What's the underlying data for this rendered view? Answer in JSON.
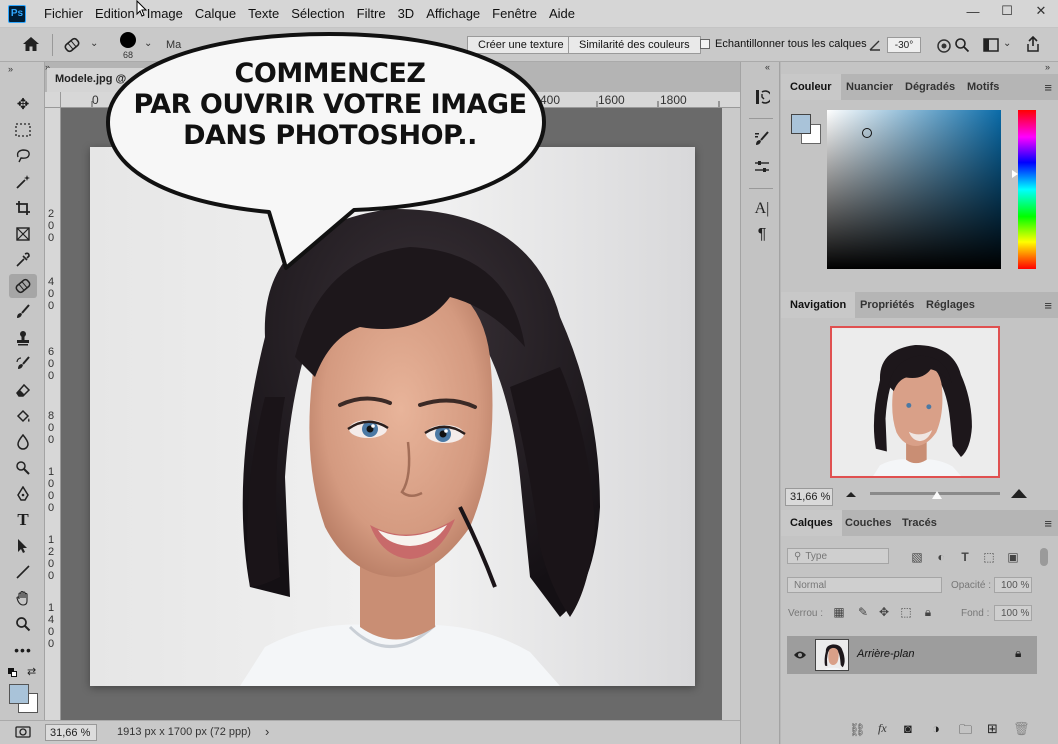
{
  "app": {
    "logo_text": "Ps"
  },
  "menu": [
    "Fichier",
    "Edition",
    "Image",
    "Calque",
    "Texte",
    "Sélection",
    "Filtre",
    "3D",
    "Affichage",
    "Fenêtre",
    "Aide"
  ],
  "window_controls": {
    "minimize": "—",
    "maximize": "☐",
    "close": "✕"
  },
  "options_bar": {
    "brush_size": "68",
    "mode_label": "Ma",
    "create_texture": "Créer une texture",
    "color_similarity": "Similarité des couleurs",
    "sample_all_layers": "Echantillonner tous les calques",
    "angle_value": "-30°"
  },
  "document": {
    "tab_title": "Modele.jpg @",
    "ruler_labels": [
      "0",
      "400",
      "1600",
      "1800"
    ],
    "left_ruler_labels": [
      "2",
      "0",
      "0",
      "4",
      "0",
      "0",
      "6",
      "0",
      "0",
      "8",
      "0",
      "0",
      "1",
      "0",
      "0",
      "0",
      "1",
      "2",
      "0",
      "0",
      "1",
      "4",
      "0",
      "0"
    ]
  },
  "status": {
    "zoom": "31,66 %",
    "dimensions": "1913 px x 1700 px (72 ppp)",
    "arrow": "›"
  },
  "speech_bubble": {
    "lines": [
      "COMMENCEZ",
      "PAR OUVRIR VOTRE IMAGE",
      "DANS PHOTOSHOP.."
    ]
  },
  "color_panel": {
    "tabs": [
      "Couleur",
      "Nuancier",
      "Dégradés",
      "Motifs"
    ],
    "foreground": "#a9c3d9",
    "background": "#ffffff",
    "hue_color": "#0a6ba8"
  },
  "navigator_panel": {
    "tabs": [
      "Navigation",
      "Propriétés",
      "Réglages"
    ],
    "zoom": "31,66 %",
    "slider_fraction": 0.51
  },
  "layers_panel": {
    "tabs": [
      "Calques",
      "Couches",
      "Tracés"
    ],
    "filter_placeholder": "Type",
    "blend_mode": "Normal",
    "opacity_label": "Opacité :",
    "opacity_value": "100 %",
    "lock_label": "Verrou :",
    "fill_label": "Fond :",
    "fill_value": "100 %",
    "layer_name": "Arrière-plan"
  }
}
